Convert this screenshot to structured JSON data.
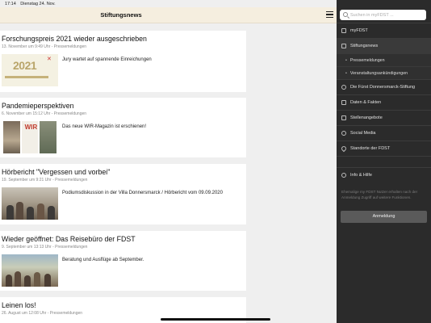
{
  "status": {
    "time": "17:14",
    "date": "Dienstag 24. Nov."
  },
  "header": {
    "title": "Stiftungsnews"
  },
  "cards": [
    {
      "title": "Forschungspreis 2021 wieder ausgeschrieben",
      "meta": "13. November um 9:49 Uhr - Pressemeldungen",
      "text": "Jury wartet auf spannende Einreichungen",
      "thumb_year": "2021",
      "thumb_mark": "✕"
    },
    {
      "title": "Pandemieperspektiven",
      "meta": "6. November um 15:12 Uhr - Pressemeldungen",
      "text": "Das neue WIR-Magazin ist erschienen!",
      "thumb_logo": "WIR"
    },
    {
      "title": "Hörbericht \"Vergessen und vorbei\"",
      "meta": "19. September um 9:21 Uhr - Pressemeldungen",
      "text": "Podiumsdiskussion in der Villa Donnersmarck / Hörbericht vom 09.09.2020"
    },
    {
      "title": "Wieder geöffnet: Das Reisebüro der FDST",
      "meta": "9. September um 13:13 Uhr - Pressemeldungen",
      "text": "Beratung und Ausflüge ab September."
    },
    {
      "title": "Leinen los!",
      "meta": "26. August um 12:08 Uhr - Pressemeldungen"
    }
  ],
  "sidebar": {
    "search_placeholder": "Suchen in myFDST ...",
    "items": [
      {
        "label": "myFDST",
        "icon": "home-icon"
      },
      {
        "label": "Stiftungsnews",
        "icon": "news-icon"
      },
      {
        "label": "Die Fürst Donnersmarck-Stiftung",
        "icon": "info-icon"
      },
      {
        "label": "Daten & Fakten",
        "icon": "chart-icon"
      },
      {
        "label": "Stellenangebote",
        "icon": "jobs-icon"
      },
      {
        "label": "Social Media",
        "icon": "social-icon"
      },
      {
        "label": "Standorte der FDST",
        "icon": "location-icon"
      },
      {
        "label": "Info & Hilfe",
        "icon": "help-icon"
      }
    ],
    "sub_items": [
      {
        "label": "Pressemeldungen"
      },
      {
        "label": "Veranstaltungsankündigungen"
      }
    ],
    "notice": "Ehemalige my FDST Nutzer erhalten nach der Anmeldung Zugriff auf weitere Funktionen.",
    "login_label": "Anmeldung"
  },
  "colors": {
    "header_bg": "#f5eedf",
    "sidebar_bg": "#2b2b2b",
    "button_bg": "#5a5a5a"
  }
}
